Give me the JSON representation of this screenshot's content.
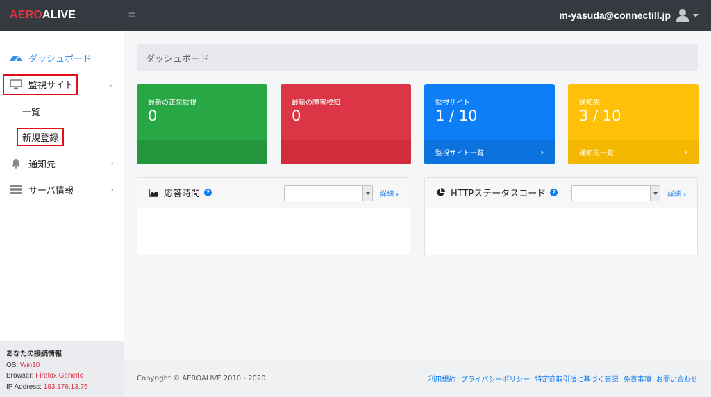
{
  "app": {
    "logo_part1": "AERO",
    "logo_part2": "ALIVE",
    "menu_glyph": "≡",
    "user_email": "m-yasuda@connectill.jp"
  },
  "colors": {
    "topbar": "#343a40",
    "brand_red": "#dc3545",
    "accent_blue": "#0d7ef5",
    "card_green": "#28a745",
    "card_red": "#dc3545",
    "card_blue": "#0d7ef5",
    "card_yellow": "#ffc107",
    "highlight_box": "#e0101a"
  },
  "sidebar": {
    "dashboard_label": "ダッシュボード",
    "monitor_label": "監視サイト",
    "sub_list_label": "一覧",
    "sub_new_label": "新規登録",
    "notify_label": "通知先",
    "server_label": "サーバ情報",
    "chevron_down": "⌄",
    "chevron_right": "›"
  },
  "connection": {
    "title": "あなたの接続情報",
    "os_label": "OS: ",
    "os_value": "Win10",
    "browser_label": "Browser: ",
    "browser_value": "Firefox Generic",
    "ip_label": "IP Address: ",
    "ip_value": "183.176.13.75"
  },
  "breadcrumb": "ダッシュボード",
  "cards": [
    {
      "label": "最新の正常監視",
      "value": "0",
      "footer": ""
    },
    {
      "label": "最新の障害検知",
      "value": "0",
      "footer": ""
    },
    {
      "label": "監視サイト",
      "value": "1 / 10",
      "footer": "監視サイト一覧",
      "arrow": "›"
    },
    {
      "label": "通知先",
      "value": "3 / 10",
      "footer": "通知先一覧",
      "arrow": "›"
    }
  ],
  "panels": [
    {
      "title": "応答時間",
      "icon": "area-chart-icon",
      "select_value": "",
      "detail": "詳細",
      "arrow": "›"
    },
    {
      "title": "HTTPステータスコード",
      "icon": "pie-chart-icon",
      "select_value": "",
      "detail": "詳細",
      "arrow": "›"
    }
  ],
  "help_glyph": "?",
  "footer": {
    "copyright": "Copyright © AEROALIVE 2010 - 2020",
    "links": [
      "利用規約",
      "プライバシーポリシー",
      "特定商取引法に基づく表記",
      "免責事項",
      "お問い合わせ"
    ],
    "separator": "·"
  }
}
